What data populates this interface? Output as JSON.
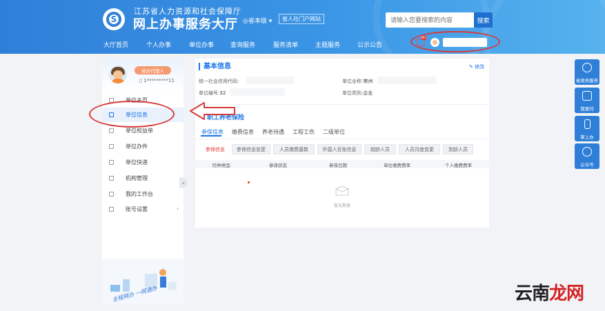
{
  "header": {
    "org_name": "江苏省人力资源和社会保障厅",
    "site_title": "网上办事服务大厅",
    "region": "◎省本级 ▾",
    "portal_link": "省人社门户网站",
    "search_placeholder": "请输入您要搜索的内容",
    "search_button": "搜索",
    "nav": [
      "大厅首页",
      "个人办事",
      "单位办事",
      "查询服务",
      "服务清单",
      "主题服务",
      "公示公告"
    ],
    "msg_badge": "99+"
  },
  "sidebar": {
    "role_tag": "经办代理人",
    "phone": "1*********11",
    "items": [
      {
        "label": "单位主页",
        "icon": "home-icon"
      },
      {
        "label": "单位信息",
        "icon": "info-icon"
      },
      {
        "label": "单位权益单",
        "icon": "rights-icon"
      },
      {
        "label": "单位办件",
        "icon": "file-icon"
      },
      {
        "label": "单位快递",
        "icon": "express-icon"
      },
      {
        "label": "机构管理",
        "icon": "org-icon"
      },
      {
        "label": "我的工作台",
        "icon": "desk-icon"
      },
      {
        "label": "账号设置",
        "icon": "settings-icon",
        "arrow": "›"
      }
    ],
    "collapse": "«",
    "illustration_text": "全程网办 一网通办"
  },
  "basic_info": {
    "title": "基本信息",
    "edit": "✎ 修改",
    "fields": [
      {
        "label": "统一社会信用代码:",
        "value": ""
      },
      {
        "label": "单位全称:",
        "value": "常州"
      },
      {
        "label": "单位编号:",
        "value": "32"
      },
      {
        "label": "单位类别:",
        "value": "企业"
      }
    ]
  },
  "insurance": {
    "section_title": "职工养老保险",
    "tabs": [
      "参保信息",
      "缴费信息",
      "养老待遇",
      "工程工伤",
      "二级单位"
    ],
    "chips": [
      "参保信息",
      "参保信息变更",
      "人员缴费基数",
      "外国人豆免信息",
      "超龄人员",
      "人员月度变更",
      "到龄人员"
    ],
    "table_headers": [
      "险种类型",
      "参保状态",
      "参保日期",
      "单位缴费费率",
      "个人缴费费率"
    ],
    "empty_text": "暂无数据"
  },
  "right_panel": [
    {
      "label": "省政务服务",
      "icon": "gov-service-icon"
    },
    {
      "label": "我要问",
      "icon": "question-icon"
    },
    {
      "label": "掌上办",
      "icon": "mobile-icon"
    },
    {
      "label": "公众号",
      "icon": "wechat-icon"
    }
  ],
  "watermark": {
    "part1": "云南",
    "part2": "龙网"
  },
  "colors": {
    "primary": "#2f7fd8",
    "accent_red": "#d83a3a",
    "green": "#2e7d32"
  }
}
